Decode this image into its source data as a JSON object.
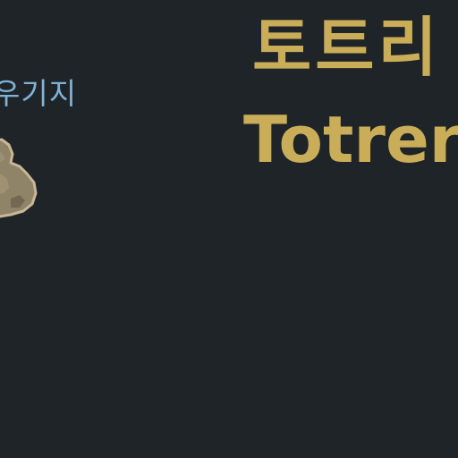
{
  "game": {
    "side_label": "우기지",
    "title_korean": "토트리",
    "title_english": "Totreri",
    "item_icon": "stone-ore-icon"
  },
  "colors": {
    "background": "#1f2428",
    "title_gold": "#c9ad58",
    "label_blue": "#7fb2d6",
    "icon_stone": "#8f8468",
    "icon_outline": "#c7b896"
  }
}
